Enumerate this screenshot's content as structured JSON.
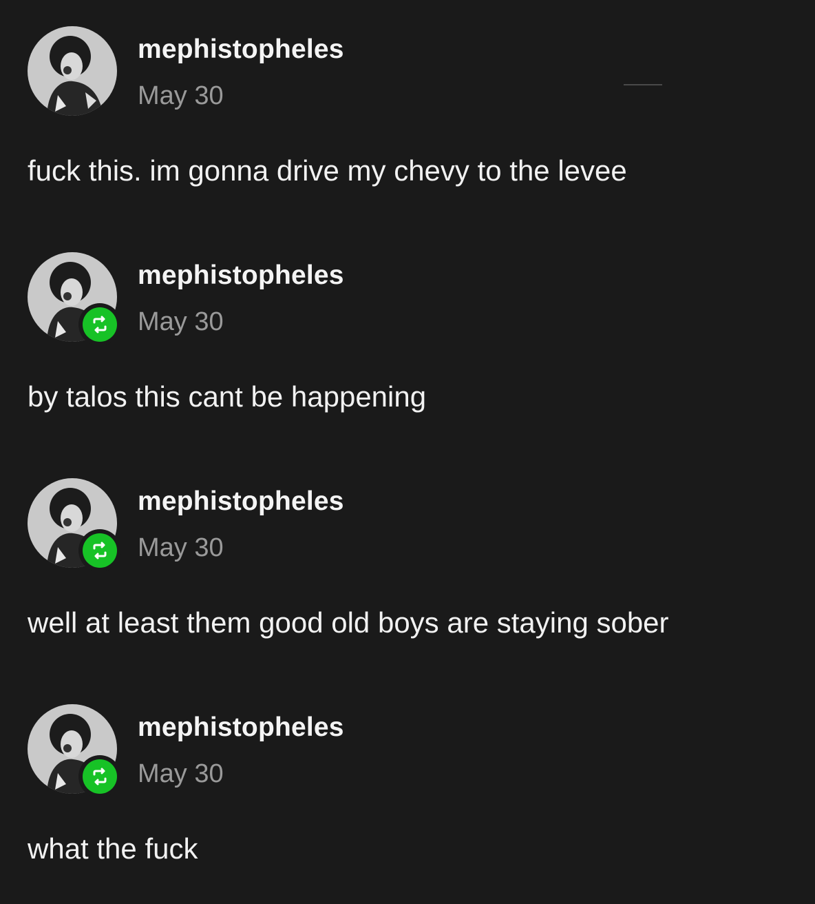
{
  "posts": [
    {
      "username": "mephistopheles",
      "date": "May 30",
      "text": "fuck this. im gonna drive my chevy to the levee",
      "reblog": false
    },
    {
      "username": "mephistopheles",
      "date": "May 30",
      "text": "by talos this cant be happening",
      "reblog": true
    },
    {
      "username": "mephistopheles",
      "date": "May 30",
      "text": "well at least them good old boys are staying sober",
      "reblog": true
    },
    {
      "username": "mephistopheles",
      "date": "May 30",
      "text": "what the fuck",
      "reblog": true
    }
  ],
  "colors": {
    "background": "#1a1a1a",
    "username": "#f4f4f4",
    "date": "#9a9a9a",
    "text": "#f2f2f2",
    "reblog_badge": "#17c226"
  },
  "icons": {
    "reblog": "reblog-icon",
    "avatar": "avatar"
  }
}
